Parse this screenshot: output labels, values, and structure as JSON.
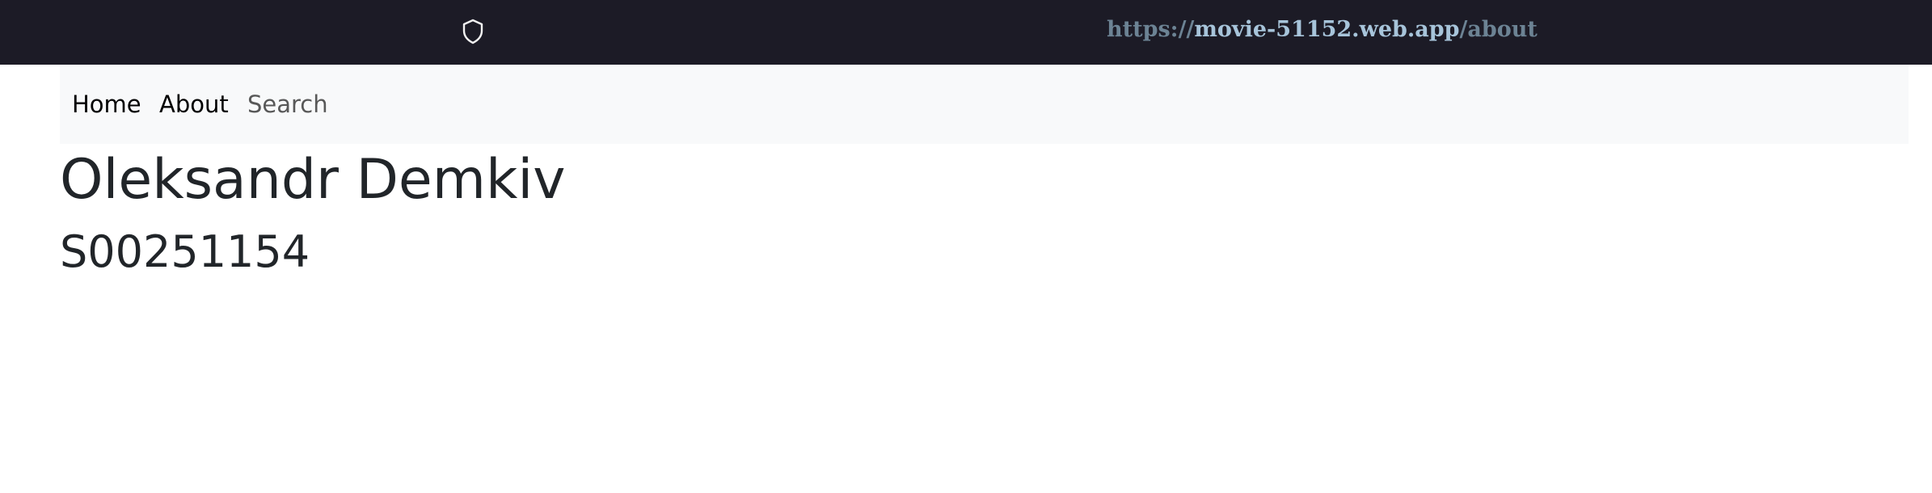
{
  "browser": {
    "shield_icon": "shield-icon",
    "url": {
      "scheme": "https://",
      "host": "movie-51152.web.app",
      "path": "/about"
    }
  },
  "navbar": {
    "items": [
      {
        "label": "Home"
      },
      {
        "label": "About"
      },
      {
        "label": "Search"
      }
    ]
  },
  "main": {
    "title": "Oleksandr Demkiv",
    "student_id": "S00251154"
  },
  "colors": {
    "urlbar_bg": "#1c1b26",
    "navbar_bg": "#f8f9fa",
    "text": "#212529",
    "url_host": "#a7c4da",
    "url_dim": "#6c8394"
  }
}
